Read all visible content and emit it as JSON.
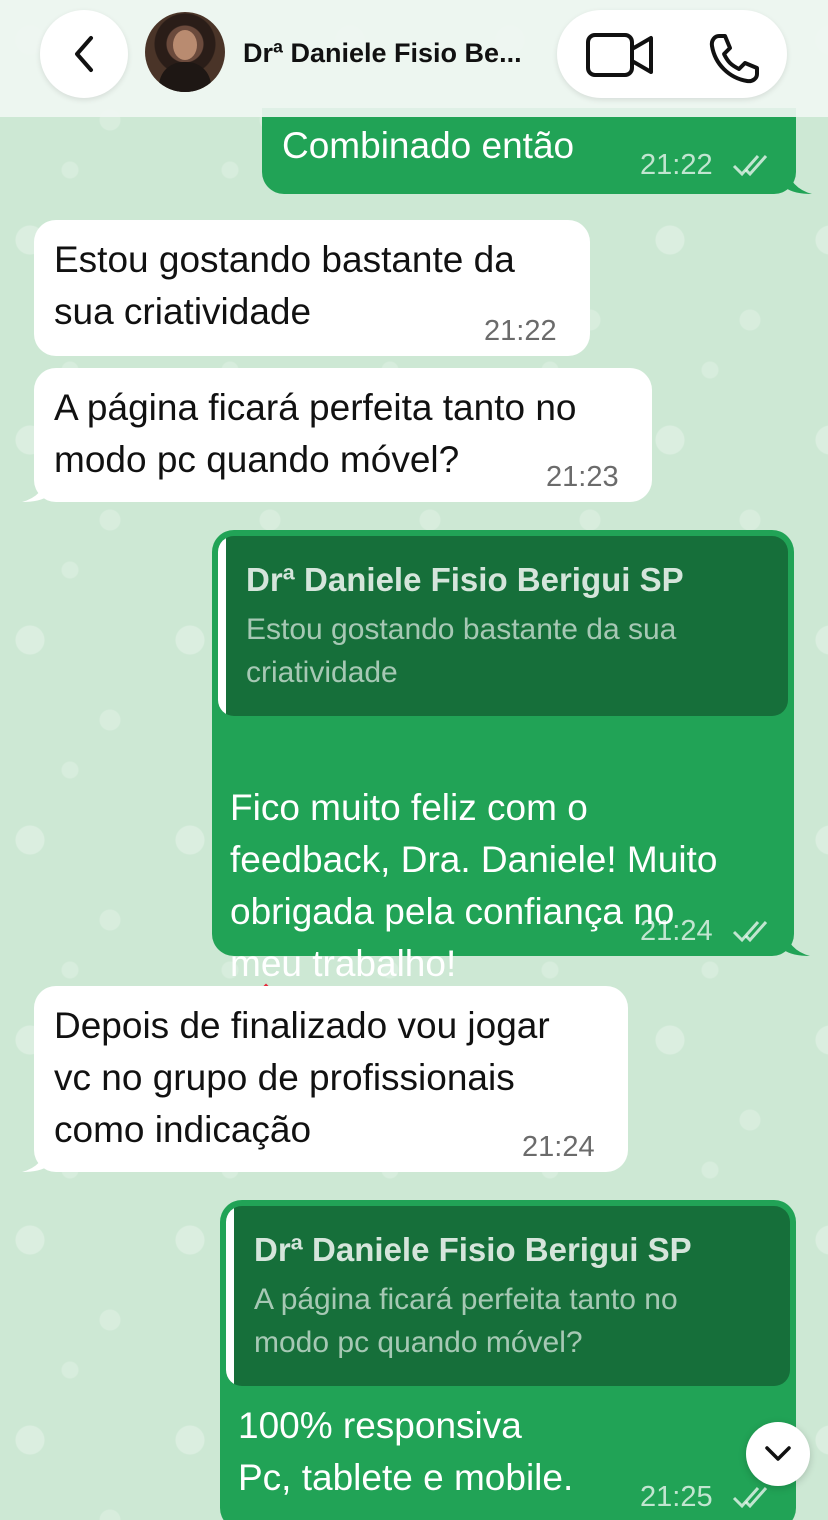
{
  "header": {
    "back_label": "back",
    "contact_name": "Drª Daniele Fisio Be...",
    "video_icon": "video-camera-icon",
    "phone_icon": "phone-icon"
  },
  "messages": [
    {
      "direction": "out",
      "text": "Combinado então",
      "time": "21:22",
      "status": "read"
    },
    {
      "direction": "in",
      "text": "Estou gostando bastante da\nsua criatividade",
      "time": "21:22"
    },
    {
      "direction": "in",
      "text": "A página ficará perfeita tanto no\nmodo pc quando móvel?",
      "time": "21:23"
    },
    {
      "direction": "out",
      "quote": {
        "author": "Drª Daniele Fisio Berigui SP",
        "text": "Estou gostando bastante da sua\ncriatividade"
      },
      "text": "Fico muito feliz com o\nfeedback, Dra. Daniele! Muito\nobrigada pela confiança no\nmeu trabalho!",
      "emoji": "smiling-face-with-hearts",
      "time": "21:24",
      "status": "read"
    },
    {
      "direction": "in",
      "text": "Depois de finalizado vou jogar\nvc no grupo de profissionais\ncomo indicação",
      "time": "21:24"
    },
    {
      "direction": "out",
      "quote": {
        "author": "Drª Daniele Fisio Berigui SP",
        "text": "A página ficará perfeita tanto no\nmodo pc quando móvel?"
      },
      "text": "100% responsiva\nPc, tablete e mobile.",
      "time": "21:25",
      "status": "read"
    }
  ],
  "scroll_button_icon": "chevron-down-icon",
  "colors": {
    "outgoing_bubble": "#21a356",
    "quote_background": "#166f3a",
    "incoming_bubble": "#ffffff",
    "wallpaper": "#cde8d4"
  }
}
